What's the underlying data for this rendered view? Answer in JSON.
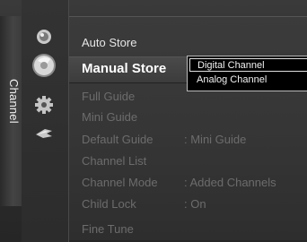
{
  "side_tab": {
    "label": "Channel"
  },
  "icons": [
    "picture-icon",
    "channel-icon",
    "setup-icon",
    "input-icon"
  ],
  "menu": {
    "items": [
      {
        "label": "Auto Store",
        "value": "",
        "state": "active"
      },
      {
        "label": "Manual Store",
        "value": "",
        "state": "selected"
      },
      {
        "label": "Full Guide",
        "value": "",
        "state": "disabled"
      },
      {
        "label": "Mini Guide",
        "value": "",
        "state": "disabled"
      },
      {
        "label": "Default Guide",
        "value": ": Mini Guide",
        "state": "disabled"
      },
      {
        "label": "Channel List",
        "value": "",
        "state": "disabled"
      },
      {
        "label": "Channel Mode",
        "value": ": Added Channels",
        "state": "disabled"
      },
      {
        "label": "Child Lock",
        "value": ": On",
        "state": "disabled"
      },
      {
        "label": "Fine Tune",
        "value": "",
        "state": "disabled"
      }
    ]
  },
  "dropdown": {
    "options": [
      "Digital Channel",
      "Analog Channel"
    ],
    "selected": "Digital Channel"
  }
}
